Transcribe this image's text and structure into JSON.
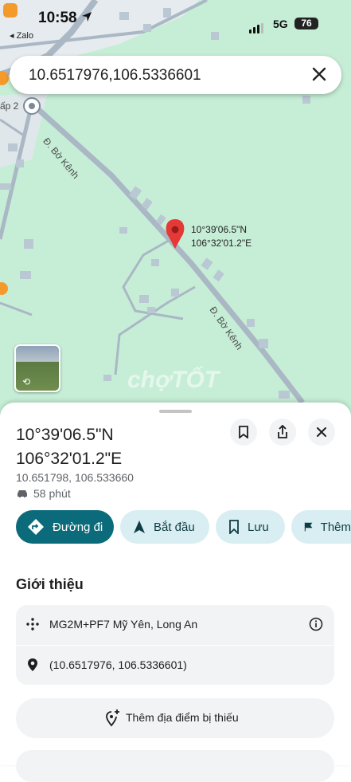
{
  "status_bar": {
    "time": "10:58",
    "back_app": "◂ Zalo",
    "network": "5G",
    "battery": "76"
  },
  "search": {
    "query": "10.6517976,106.5336601"
  },
  "map": {
    "road_label_top": "Đ. Bờ Kênh",
    "road_label_bottom": "Đ. Bờ Kênh",
    "area_label": "ấp 2",
    "pin_label_lat": "10°39'06.5\"N",
    "pin_label_lng": "106°32'01.2\"E",
    "watermark": "chợTỐT",
    "colors": {
      "land": "#c6eed6",
      "road": "#aab7c4",
      "pin": "#e53935"
    }
  },
  "sheet": {
    "title_line1": "10°39'06.5\"N",
    "title_line2": "106°32'01.2\"E",
    "coords": "10.651798, 106.533660",
    "travel_time": "58 phút",
    "actions": {
      "directions": "Đường đi",
      "start": "Bắt đầu",
      "save": "Lưu",
      "flag": "Thêm"
    },
    "section_title": "Giới thiệu",
    "plus_code": "MG2M+PF7 Mỹ Yên, Long An",
    "latlng": "(10.6517976, 106.5336601)",
    "add_missing": "Thêm địa điểm bị thiếu",
    "accent": "#0b6b7a"
  }
}
